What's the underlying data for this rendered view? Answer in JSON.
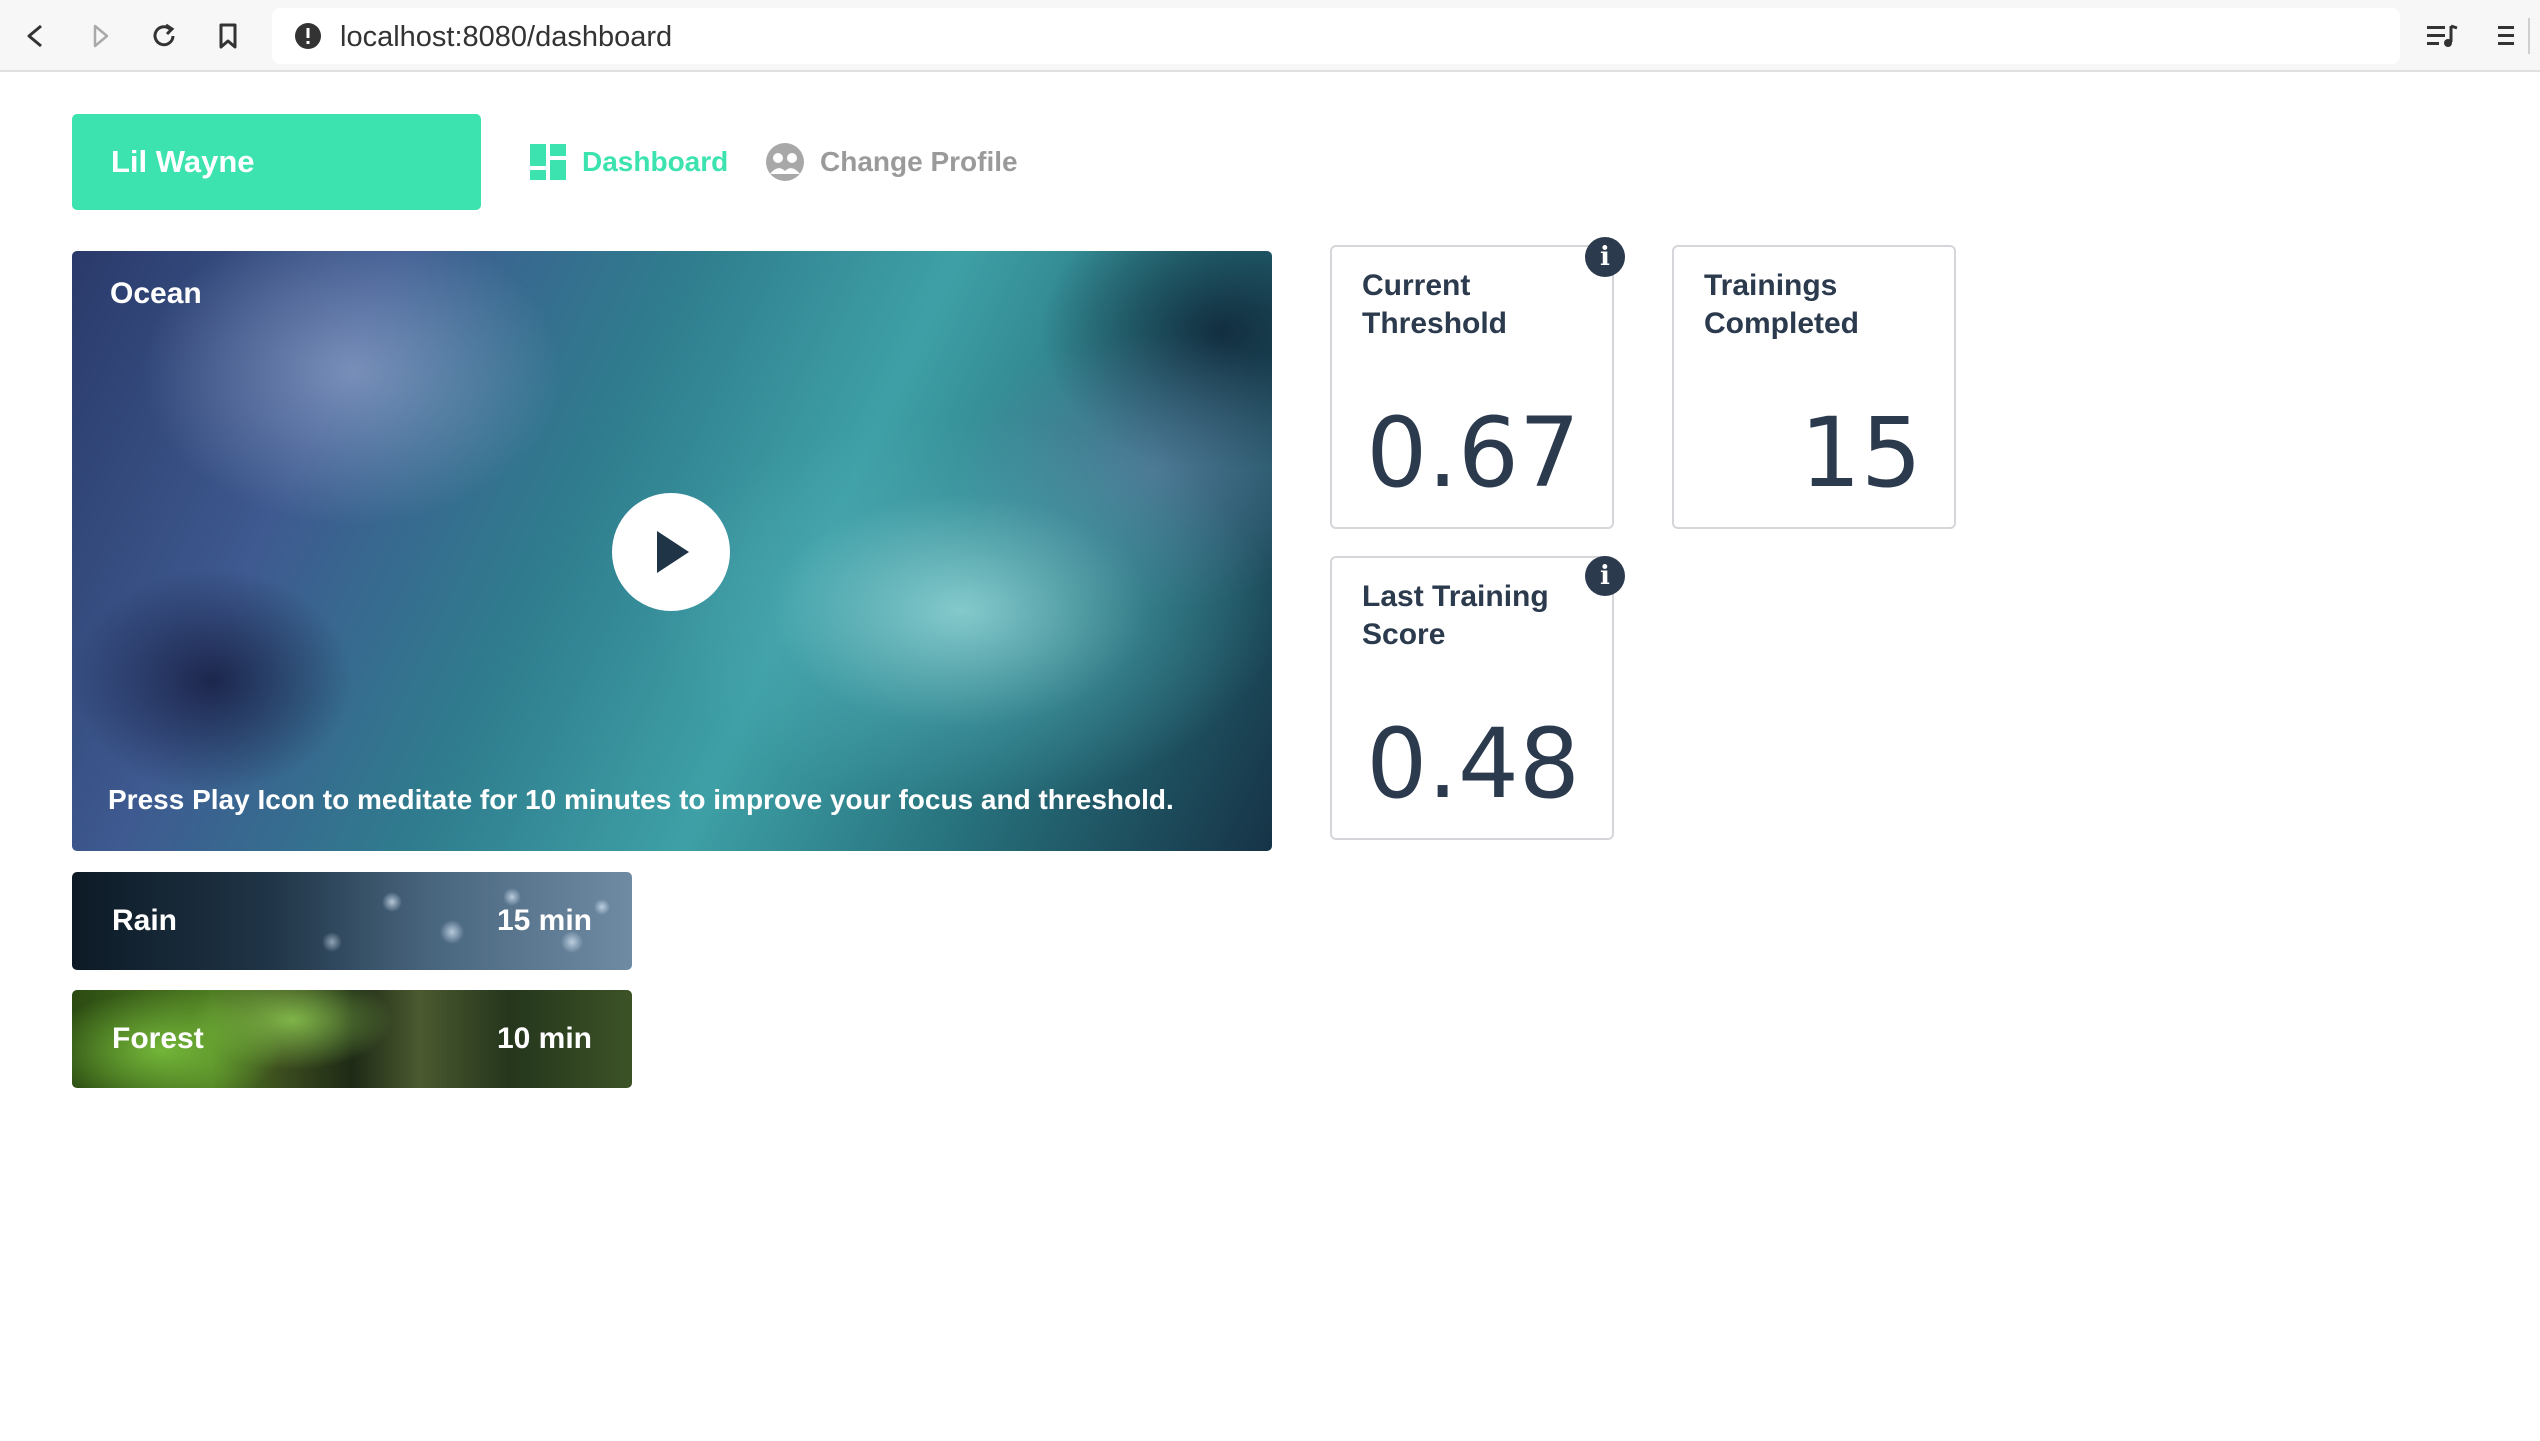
{
  "browser": {
    "url": "localhost:8080/dashboard"
  },
  "header": {
    "user_name": "Lil Wayne",
    "nav": [
      {
        "label": "Dashboard",
        "active": true,
        "icon": "dashboard-grid-icon",
        "color": "#3ce3ae"
      },
      {
        "label": "Change Profile",
        "active": false,
        "icon": "profile-icon",
        "color": "#9a9a9a"
      }
    ]
  },
  "player": {
    "title": "Ocean",
    "caption": "Press Play Icon to meditate for 10 minutes to improve your focus and threshold.",
    "icon": "play-icon"
  },
  "tracks": [
    {
      "name": "Rain",
      "duration": "15 min"
    },
    {
      "name": "Forest",
      "duration": "10 min"
    }
  ],
  "stats": {
    "current_threshold": {
      "title": "Current Threshold",
      "value": "0.67",
      "info_icon": "info-icon"
    },
    "trainings_completed": {
      "title": "Trainings Completed",
      "value": "15"
    },
    "last_training_score": {
      "title": "Last Training Score",
      "value": "0.48",
      "info_icon": "info-icon"
    }
  },
  "colors": {
    "accent": "#3ce3ae",
    "text_dark": "#2b3a4d",
    "muted": "#9a9a9a"
  }
}
